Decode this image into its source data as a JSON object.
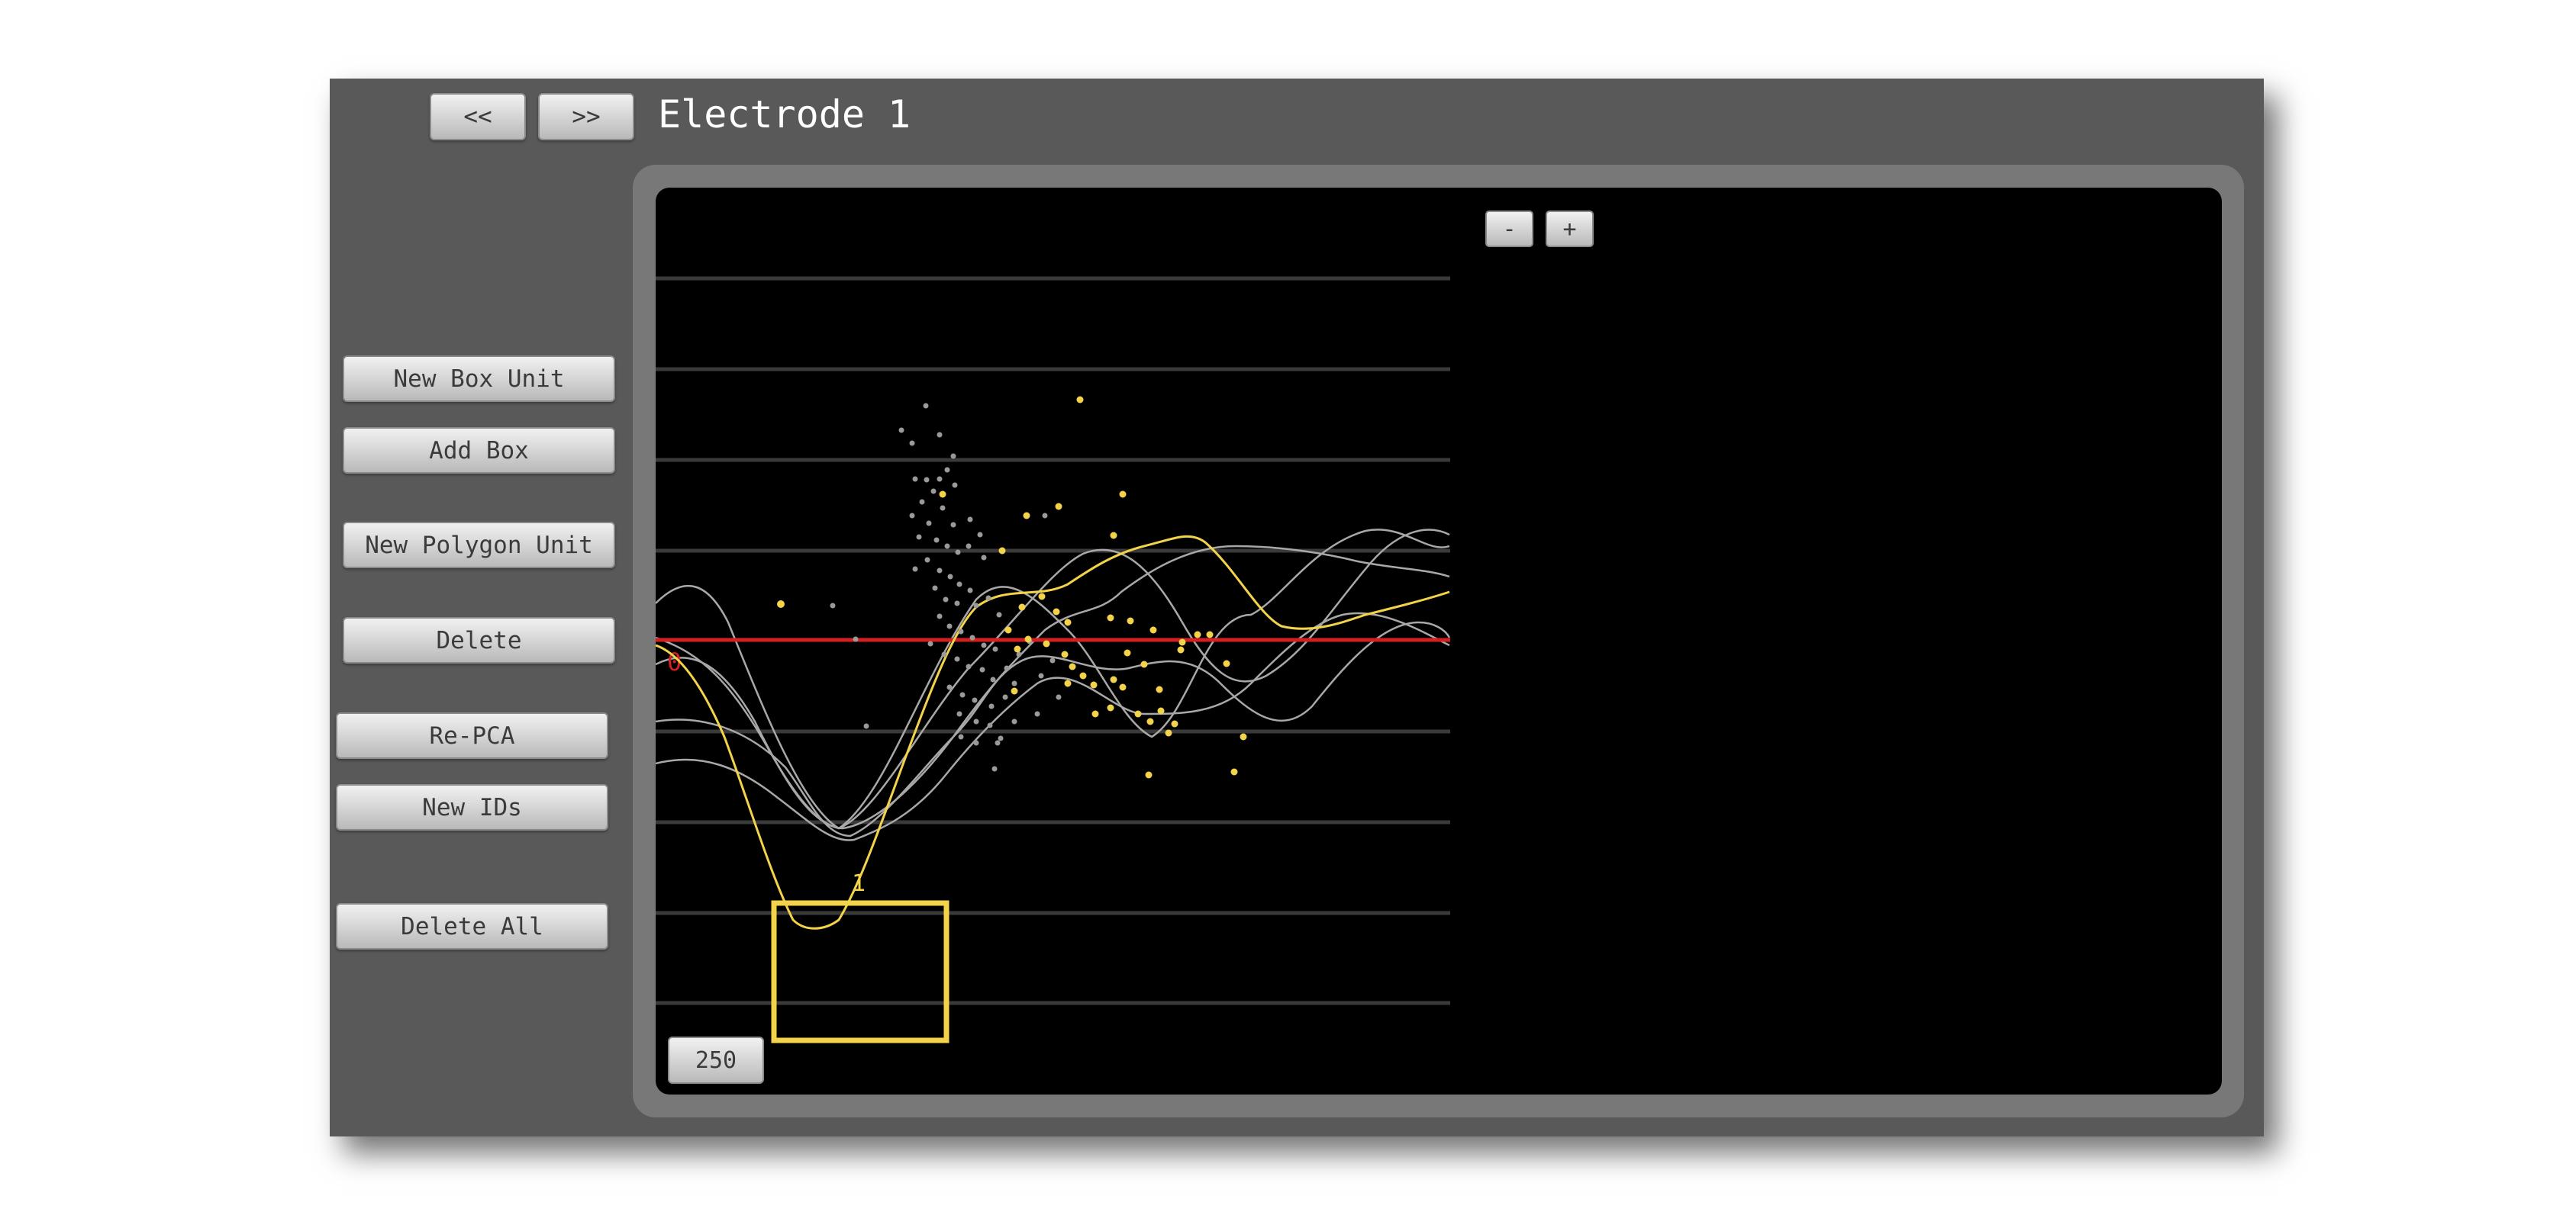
{
  "nav": {
    "prev_label": "<<",
    "next_label": ">>"
  },
  "title": "Electrode 1",
  "sidebar": {
    "new_box_unit": "New Box Unit",
    "add_box": "Add Box",
    "new_polygon_unit": "New Polygon Unit",
    "delete": "Delete",
    "re_pca": "Re-PCA",
    "new_ids": "New IDs",
    "delete_all": "Delete All"
  },
  "waveform": {
    "threshold_label": "0",
    "box_unit_label": "1",
    "rate_label": "250",
    "colors": {
      "background": "#000000",
      "gridline": "#3a3a3a",
      "threshold": "#d42020",
      "unit_yellow": "#f3d34a",
      "unsorted": "#a8a8a8"
    }
  },
  "pca": {
    "zoom_out_label": "-",
    "zoom_in_label": "+"
  }
}
